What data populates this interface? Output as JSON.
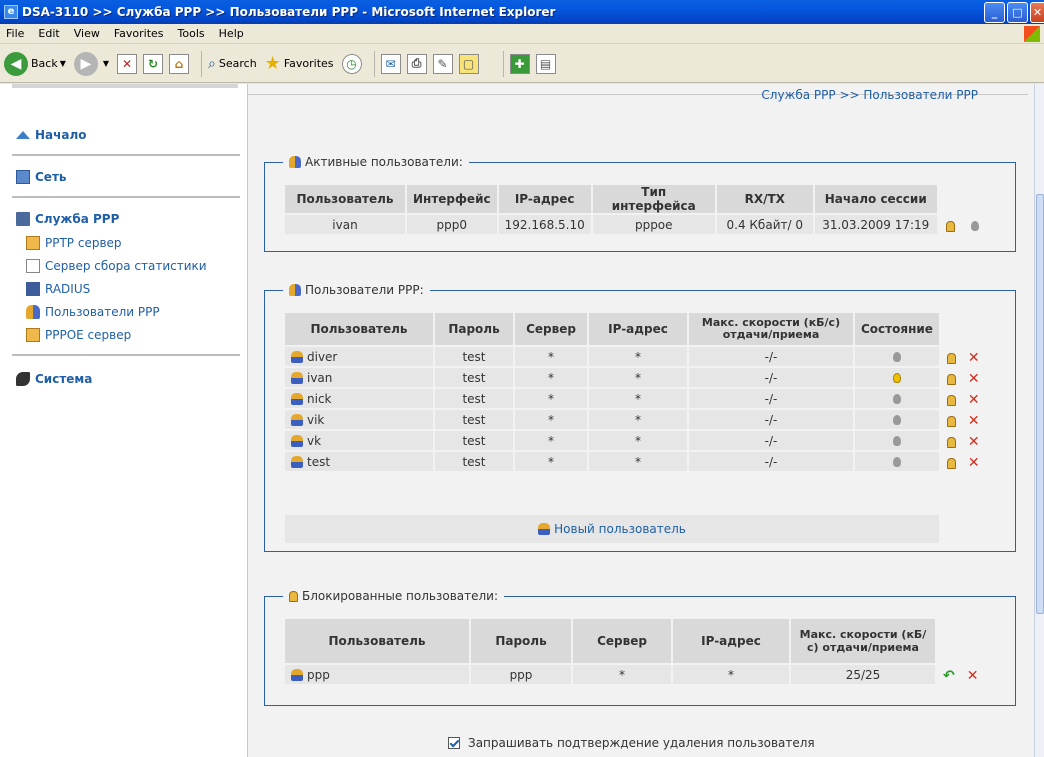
{
  "window": {
    "title": "DSA-3110 >> Служба PPP >> Пользователи PPP - Microsoft Internet Explorer"
  },
  "menu": [
    "File",
    "Edit",
    "View",
    "Favorites",
    "Tools",
    "Help"
  ],
  "toolbar": {
    "back": "Back",
    "search": "Search",
    "favorites": "Favorites"
  },
  "breadcrumb": "Служба PPP >> Пользователи PPP",
  "sidebar": {
    "home": "Начало",
    "net": "Сеть",
    "ppp": "Служба PPP",
    "ppp_items": [
      "PPTP сервер",
      "Сервер сбора статистики",
      "RADIUS",
      "Пользователи PPP",
      "PPPOE сервер"
    ],
    "system": "Система"
  },
  "active": {
    "legend": "Активные пользователи:",
    "headers": [
      "Пользователь",
      "Интерфейс",
      "IP-адрес",
      "Тип интерфейса",
      "RX/TX",
      "Начало сессии"
    ],
    "rows": [
      [
        "ivan",
        "ppp0",
        "192.168.5.10",
        "pppoe",
        "0.4 Кбайт/ 0",
        "31.03.2009 17:19"
      ]
    ]
  },
  "ppp_users": {
    "legend": "Пользователи PPP:",
    "headers": [
      "Пользователь",
      "Пароль",
      "Сервер",
      "IP-адрес",
      "Макс. скорости (кБ/с) отдачи/приема",
      "Состояние"
    ],
    "rows": [
      {
        "user": "diver",
        "pass": "test",
        "server": "*",
        "ip": "*",
        "speed": "-/-",
        "active": false
      },
      {
        "user": "ivan",
        "pass": "test",
        "server": "*",
        "ip": "*",
        "speed": "-/-",
        "active": true
      },
      {
        "user": "nick",
        "pass": "test",
        "server": "*",
        "ip": "*",
        "speed": "-/-",
        "active": false
      },
      {
        "user": "vik",
        "pass": "test",
        "server": "*",
        "ip": "*",
        "speed": "-/-",
        "active": false
      },
      {
        "user": "vk",
        "pass": "test",
        "server": "*",
        "ip": "*",
        "speed": "-/-",
        "active": false
      },
      {
        "user": "test",
        "pass": "test",
        "server": "*",
        "ip": "*",
        "speed": "-/-",
        "active": false
      }
    ],
    "new_user": "Новый пользователь"
  },
  "blocked": {
    "legend": "Блокированные пользователи:",
    "headers": [
      "Пользователь",
      "Пароль",
      "Сервер",
      "IP-адрес",
      "Макс. скорости (кБ/с) отдачи/приема"
    ],
    "rows": [
      {
        "user": "ppp",
        "pass": "ppp",
        "server": "*",
        "ip": "*",
        "speed": "25/25"
      }
    ]
  },
  "confirm_delete": "Запрашивать подтверждение удаления пользователя"
}
